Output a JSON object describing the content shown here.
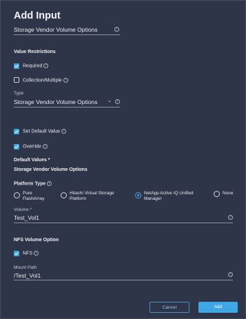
{
  "dialog": {
    "title": "Add Input",
    "name_value": "Storage Vendor Volume Options"
  },
  "value_restrictions": {
    "heading": "Value Restrictions",
    "required_label": "Required",
    "required_checked": true,
    "collection_label": "Collection/Multiple",
    "collection_checked": false,
    "type_label": "Type",
    "type_value": "Storage Vendor Volume Options"
  },
  "defaults": {
    "set_default_label": "Set Default Value",
    "set_default_checked": true,
    "override_label": "Override",
    "override_checked": true,
    "heading": "Default Values *",
    "subheading": "Storage Vendor Volume Options"
  },
  "platform": {
    "label": "Platform Type",
    "options": [
      {
        "label": "Pure FlashArray",
        "selected": false
      },
      {
        "label": "Hitachi Virtual Storage Platform",
        "selected": false
      },
      {
        "label": "NetApp Active IQ Unified Manager",
        "selected": true
      },
      {
        "label": "None",
        "selected": false
      }
    ]
  },
  "volume": {
    "label": "Volume *",
    "value": "Test_Vol1"
  },
  "nfs": {
    "heading": "NFS Volume Option",
    "nfs_label": "NFS",
    "nfs_checked": true,
    "mount_path_label": "Mount Path",
    "mount_path_value": "/Test_Vol1"
  },
  "footer": {
    "cancel_label": "Cancel",
    "add_label": "Add"
  },
  "colors": {
    "background": "#2f3548",
    "accent": "#3fa7e3",
    "text": "#e6e9f0"
  }
}
